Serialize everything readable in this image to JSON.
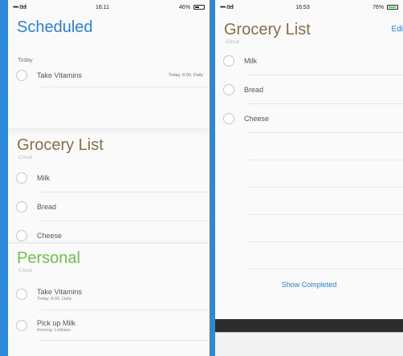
{
  "left": {
    "status": {
      "carrier": "••••◦ Bell",
      "time": "16:11",
      "battery": "46%"
    },
    "scheduled": {
      "title": "Scheduled",
      "section": "Today",
      "items": [
        {
          "label": "Take Vitamins",
          "meta": "Today, 8:00, Daily"
        }
      ]
    },
    "grocery": {
      "title": "Grocery List",
      "account": "iCloud",
      "items": [
        "Milk",
        "Bread",
        "Cheese"
      ]
    },
    "personal": {
      "title": "Personal",
      "account": "iCloud",
      "items": [
        {
          "label": "Take Vitamins",
          "meta": "Today, 8:00, Daily"
        },
        {
          "label": "Pick up Milk",
          "meta": "Arriving: Loblaws"
        }
      ]
    }
  },
  "right": {
    "status": {
      "carrier": "••••◦ Bell",
      "time": "16:53",
      "battery": "76%"
    },
    "title": "Grocery List",
    "account": "iCloud",
    "edit": "Edi",
    "items": [
      "Milk",
      "Bread",
      "Cheese"
    ],
    "show_completed": "Show Completed"
  }
}
